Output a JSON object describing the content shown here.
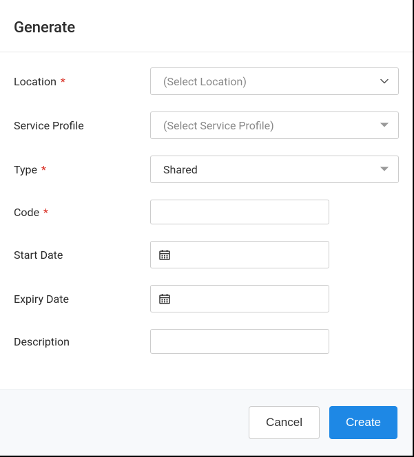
{
  "header": {
    "title": "Generate"
  },
  "labels": {
    "location": "Location",
    "service_profile": "Service Profile",
    "type": "Type",
    "code": "Code",
    "start_date": "Start Date",
    "expiry_date": "Expiry Date",
    "description": "Description",
    "required_mark": "*"
  },
  "fields": {
    "location": {
      "placeholder": "(Select Location)",
      "value": ""
    },
    "service_profile": {
      "placeholder": "(Select Service Profile)",
      "value": ""
    },
    "type": {
      "value": "Shared"
    },
    "code": {
      "value": ""
    },
    "start_date": {
      "value": ""
    },
    "expiry_date": {
      "value": ""
    },
    "description": {
      "value": ""
    }
  },
  "footer": {
    "cancel_label": "Cancel",
    "create_label": "Create"
  },
  "icons": {
    "chevron_down": "chevron-down-icon",
    "calendar": "calendar-icon"
  },
  "colors": {
    "primary": "#1e88e5",
    "required": "#d93025",
    "border": "#cccccc",
    "footer_bg": "#f7f9fb"
  }
}
